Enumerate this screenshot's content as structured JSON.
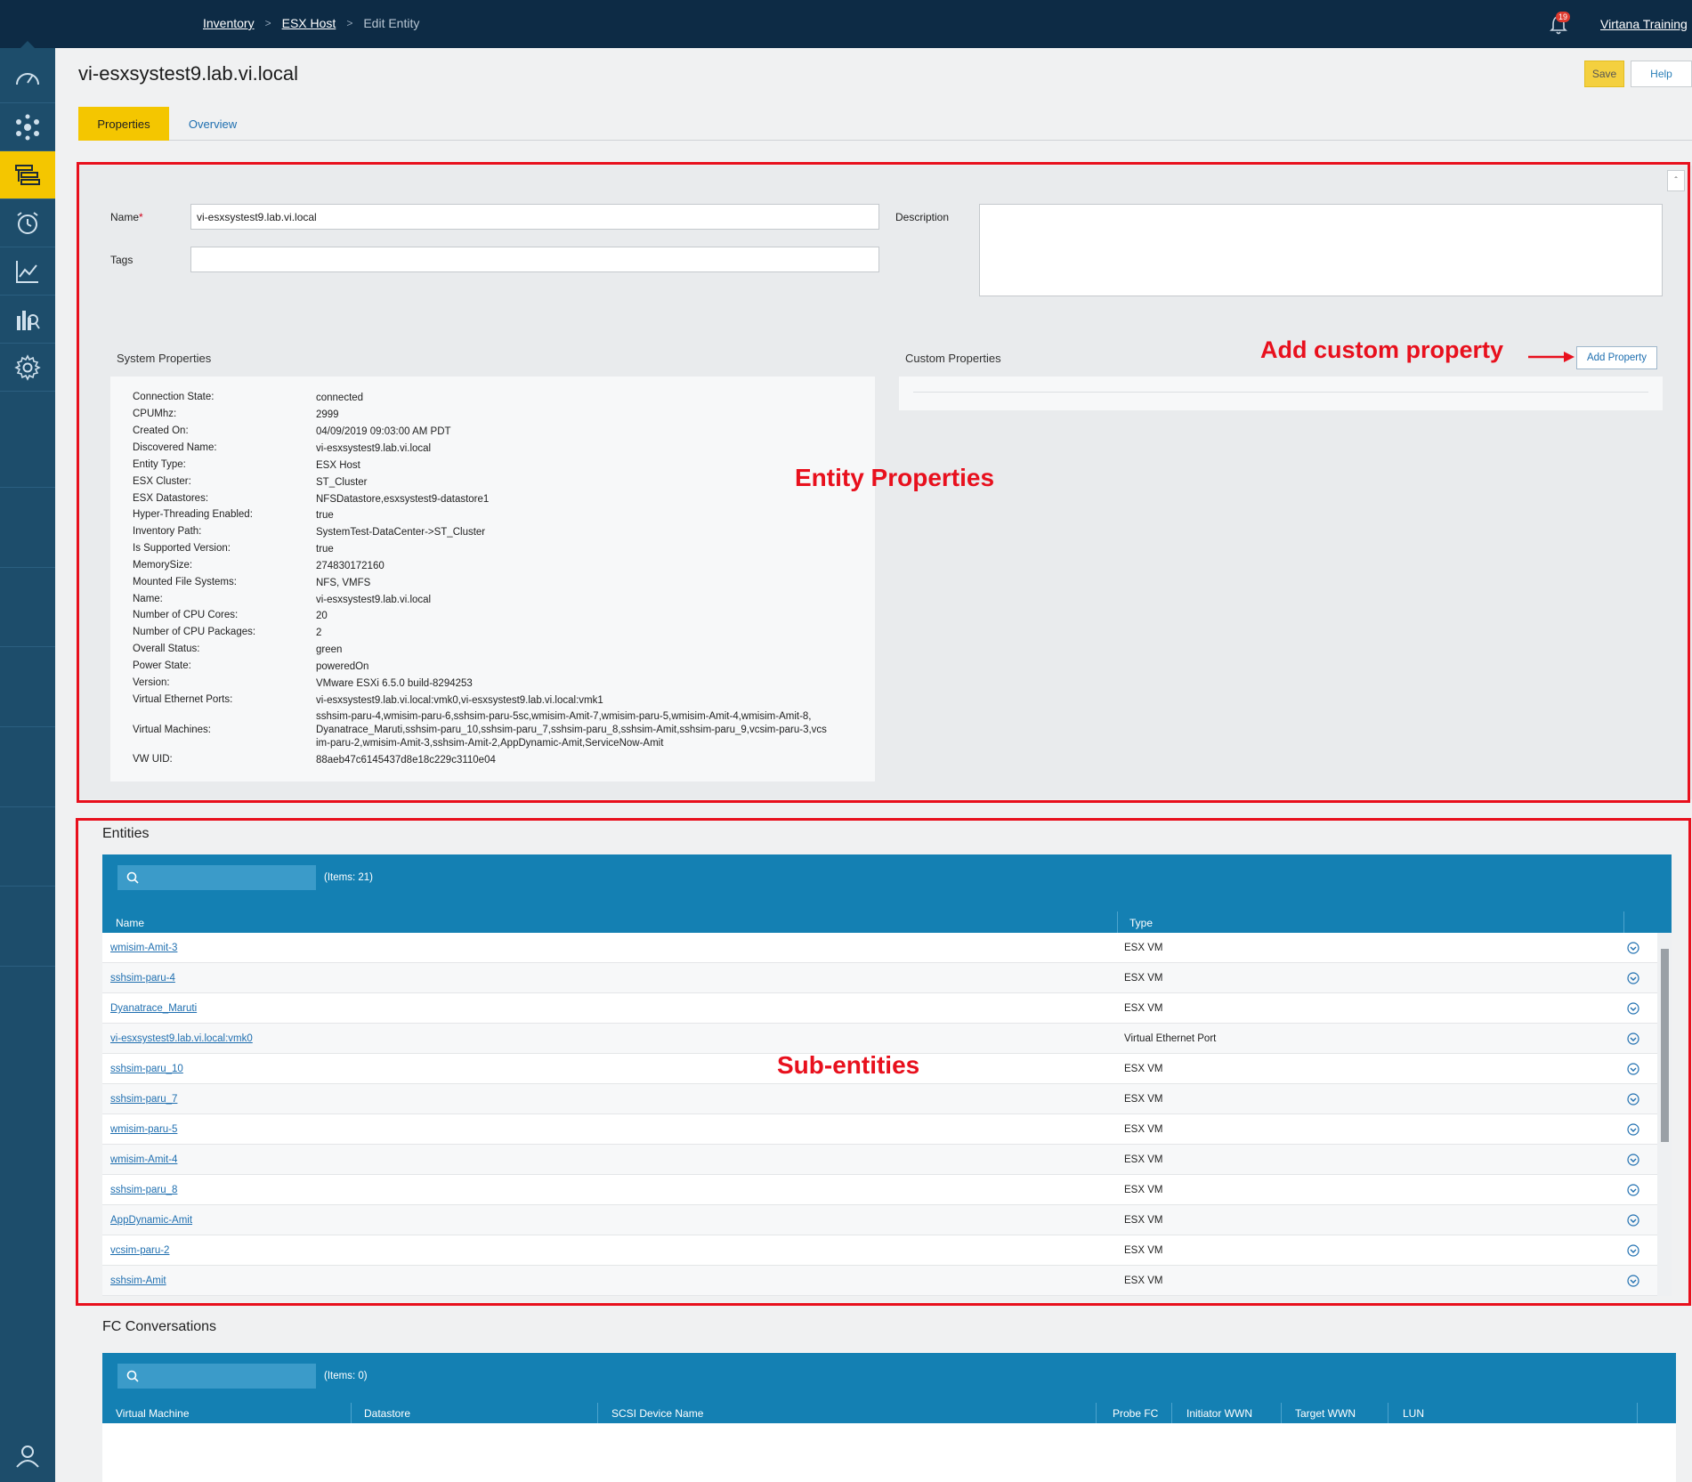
{
  "breadcrumb": {
    "items": [
      "Inventory",
      "ESX Host"
    ],
    "current": "Edit Entity"
  },
  "topbar": {
    "notification_count": "19",
    "user": "Virtana Training"
  },
  "page": {
    "title": "vi-esxsystest9.lab.vi.local",
    "save_label": "Save",
    "help_label": "Help"
  },
  "tabs": [
    "Properties",
    "Overview"
  ],
  "form": {
    "name_label": "Name",
    "required_mark": "*",
    "name_value": "vi-esxsystest9.lab.vi.local",
    "tags_label": "Tags",
    "tags_value": "",
    "description_label": "Description",
    "description_value": ""
  },
  "system_properties": {
    "title": "System Properties",
    "rows": [
      {
        "key": "Connection State:",
        "value": "connected"
      },
      {
        "key": "CPUMhz:",
        "value": "2999"
      },
      {
        "key": "Created On:",
        "value": "04/09/2019 09:03:00 AM PDT"
      },
      {
        "key": "Discovered Name:",
        "value": "vi-esxsystest9.lab.vi.local"
      },
      {
        "key": "Entity Type:",
        "value": "ESX Host"
      },
      {
        "key": "ESX Cluster:",
        "value": "ST_Cluster"
      },
      {
        "key": "ESX Datastores:",
        "value": "NFSDatastore,esxsystest9-datastore1"
      },
      {
        "key": "Hyper-Threading Enabled:",
        "value": "true"
      },
      {
        "key": "Inventory Path:",
        "value": "SystemTest-DataCenter->ST_Cluster"
      },
      {
        "key": "Is Supported Version:",
        "value": "true"
      },
      {
        "key": "MemorySize:",
        "value": "274830172160"
      },
      {
        "key": "Mounted File Systems:",
        "value": "NFS, VMFS"
      },
      {
        "key": "Name:",
        "value": "vi-esxsystest9.lab.vi.local"
      },
      {
        "key": "Number of CPU Cores:",
        "value": "20"
      },
      {
        "key": "Number of CPU Packages:",
        "value": "2"
      },
      {
        "key": "Overall Status:",
        "value": "green"
      },
      {
        "key": "Power State:",
        "value": "poweredOn"
      },
      {
        "key": "Version:",
        "value": "VMware ESXi 6.5.0 build-8294253"
      },
      {
        "key": "Virtual Ethernet Ports:",
        "value": "vi-esxsystest9.lab.vi.local:vmk0,vi-esxsystest9.lab.vi.local:vmk1"
      },
      {
        "key": "Virtual Machines:",
        "value": "sshsim-paru-4,wmisim-paru-6,sshsim-paru-5sc,wmisim-Amit-7,wmisim-paru-5,wmisim-Amit-4,wmisim-Amit-8,\nDyanatrace_Maruti,sshsim-paru_10,sshsim-paru_7,sshsim-paru_8,sshsim-Amit,sshsim-paru_9,vcsim-paru-3,vcs\nim-paru-2,wmisim-Amit-3,sshsim-Amit-2,AppDynamic-Amit,ServiceNow-Amit"
      },
      {
        "key": "VW UID:",
        "value": "88aeb47c6145437d8e18c229c3110e04"
      }
    ]
  },
  "custom_properties": {
    "title": "Custom Properties",
    "add_label": "Add Property"
  },
  "annotations": {
    "add_custom": "Add custom property",
    "entity_props": "Entity Properties",
    "sub_entities": "Sub-entities"
  },
  "entities": {
    "title": "Entities",
    "count": "(Items: 21)",
    "columns": [
      "Name",
      "Type"
    ],
    "rows": [
      {
        "name": "wmisim-Amit-3",
        "type": "ESX VM"
      },
      {
        "name": "sshsim-paru-4",
        "type": "ESX VM"
      },
      {
        "name": "Dyanatrace_Maruti",
        "type": "ESX VM"
      },
      {
        "name": "vi-esxsystest9.lab.vi.local:vmk0",
        "type": "Virtual Ethernet Port"
      },
      {
        "name": "sshsim-paru_10",
        "type": "ESX VM"
      },
      {
        "name": "sshsim-paru_7",
        "type": "ESX VM"
      },
      {
        "name": "wmisim-paru-5",
        "type": "ESX VM"
      },
      {
        "name": "wmisim-Amit-4",
        "type": "ESX VM"
      },
      {
        "name": "sshsim-paru_8",
        "type": "ESX VM"
      },
      {
        "name": "AppDynamic-Amit",
        "type": "ESX VM"
      },
      {
        "name": "vcsim-paru-2",
        "type": "ESX VM"
      },
      {
        "name": "sshsim-Amit",
        "type": "ESX VM"
      }
    ]
  },
  "fc_conversations": {
    "title": "FC Conversations",
    "count": "(Items: 0)",
    "columns": [
      "Virtual Machine",
      "Datastore",
      "SCSI Device Name",
      "Probe FC",
      "Initiator WWN",
      "Target WWN",
      "LUN"
    ]
  },
  "colors": {
    "accent": "#f4c600",
    "header": "#0d2b45",
    "sidebar": "#1d4d6b",
    "grid_header": "#1480b3",
    "annotation": "#e8101d"
  },
  "icons": [
    "gauge-icon",
    "topology-icon",
    "inventory-icon",
    "alarm-icon",
    "analytics-icon",
    "reports-icon",
    "gear-icon",
    "user-icon",
    "bell-icon",
    "search-icon",
    "chevron-down-icon"
  ]
}
